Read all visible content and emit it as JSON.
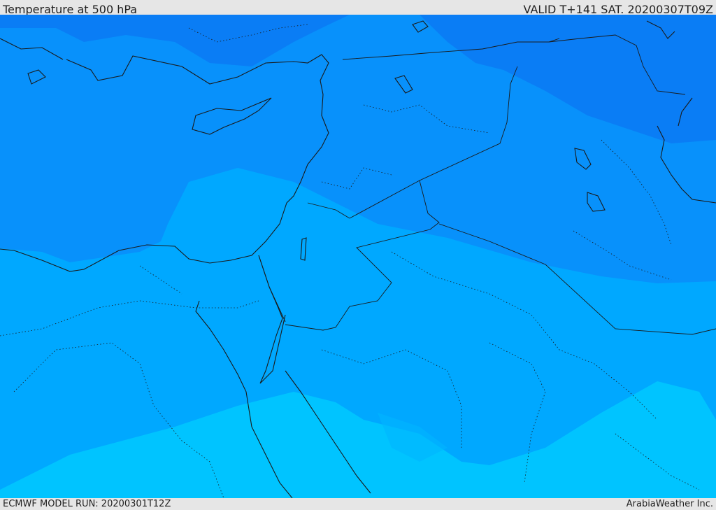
{
  "header": {
    "title": "Temperature at 500 hPa",
    "valid_time": "VALID T+141 SAT. 20200307T09Z"
  },
  "footer": {
    "model_run": "ECMWF MODEL RUN: 20200301T12Z",
    "credit": "ArabiaWeather Inc."
  },
  "colors": {
    "coldest": "#0a7df5",
    "cold": "#0891fb",
    "mid": "#00a8ff",
    "warm": "#00c4ff",
    "coastline": "#1a1a1a",
    "border": "#1a1a1a"
  }
}
